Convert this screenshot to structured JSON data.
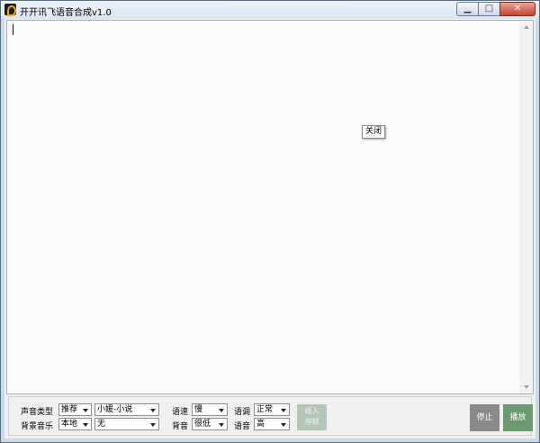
{
  "window": {
    "title": "开开讯飞语音合成v1.0",
    "icon": "app-logo-icon",
    "controls": {
      "minimize": "▁",
      "maximize": "□",
      "close": "✕"
    }
  },
  "editor": {
    "text": "",
    "popup_close_label": "关闭"
  },
  "controls": {
    "voice_type_label": "声音类型",
    "voice_type_value": "推荐",
    "voice_name_value": "小媛-小说",
    "bgm_label": "背景音乐",
    "bgm_source_value": "本地",
    "bgm_file_value": "无",
    "speed_label": "语速",
    "speed_value": "慢",
    "pitch_label": "语调",
    "pitch_value": "正常",
    "bgm_volume_label": "背音",
    "bgm_volume_value": "很低",
    "voice_volume_label": "语音",
    "voice_volume_value": "高",
    "insert_pause_line1": "插入",
    "insert_pause_line2": "停顿",
    "stop_label": "停止",
    "play_label": "播放"
  }
}
